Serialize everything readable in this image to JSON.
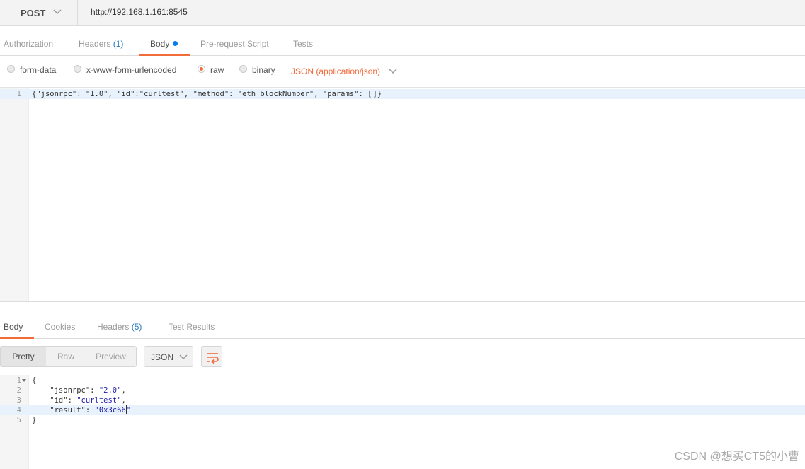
{
  "request": {
    "method": "POST",
    "url": "http://192.168.1.161:8545"
  },
  "request_tabs": [
    {
      "label": "Authorization",
      "count": ""
    },
    {
      "label": "Headers",
      "count": "(1)"
    },
    {
      "label": "Body",
      "count": ""
    },
    {
      "label": "Pre-request Script",
      "count": ""
    },
    {
      "label": "Tests",
      "count": ""
    }
  ],
  "body_options": {
    "form_data": "form-data",
    "urlencoded": "x-www-form-urlencoded",
    "raw": "raw",
    "binary": "binary",
    "content_type": "JSON (application/json)",
    "selected": "raw"
  },
  "request_body": {
    "line_number": "1",
    "prefix": "{\"jsonrpc\": \"1.0\", \"id\":\"curltest\", \"method\": \"eth_blockNumber\", \"params\": [",
    "suffix": "]}"
  },
  "response_tabs": [
    {
      "label": "Body",
      "count": ""
    },
    {
      "label": "Cookies",
      "count": ""
    },
    {
      "label": "Headers",
      "count": "(5)"
    },
    {
      "label": "Test Results",
      "count": ""
    }
  ],
  "response_toolbar": {
    "pretty": "Pretty",
    "raw": "Raw",
    "preview": "Preview",
    "format": "JSON"
  },
  "response_body": {
    "line_numbers": [
      "1",
      "2",
      "3",
      "4",
      "5"
    ],
    "line1": "{",
    "line2_key": "    \"jsonrpc\": ",
    "line2_val": "\"2.0\"",
    "line2_end": ",",
    "line3_key": "    \"id\": ",
    "line3_val": "\"curltest\"",
    "line3_end": ",",
    "line4_key": "    \"result\": ",
    "line4_val": "\"0x3c66",
    "line4_end": "\"",
    "line5": "}"
  },
  "watermark": "CSDN @想买CT5的小曹",
  "colors": {
    "accent": "#f26b3a",
    "dot": "#097bed",
    "count": "#2a7ac0"
  }
}
